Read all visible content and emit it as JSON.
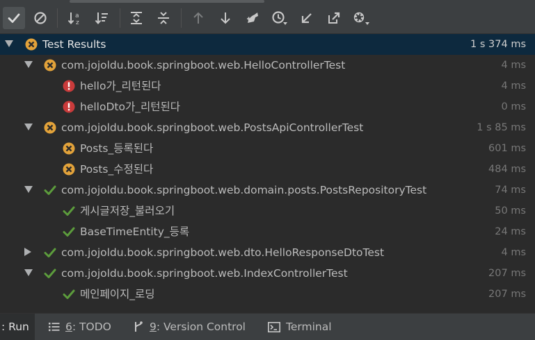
{
  "window_title": "Test Results",
  "tree": {
    "rows": [
      {
        "label": "Test Results",
        "time": "1 s 374 ms",
        "status": "ignored",
        "level": 0,
        "expand": "down",
        "selected": true
      },
      {
        "label": "com.jojoldu.book.springboot.web.HelloControllerTest",
        "time": "4 ms",
        "status": "ignored",
        "level": 1,
        "expand": "down"
      },
      {
        "label": "hello가_리턴된다",
        "time": "4 ms",
        "status": "error",
        "level": 2,
        "expand": "none"
      },
      {
        "label": "helloDto가_리턴된다",
        "time": "0 ms",
        "status": "error",
        "level": 2,
        "expand": "none"
      },
      {
        "label": "com.jojoldu.book.springboot.web.PostsApiControllerTest",
        "time": "1 s 85 ms",
        "status": "ignored",
        "level": 1,
        "expand": "down"
      },
      {
        "label": "Posts_등록된다",
        "time": "601 ms",
        "status": "ignored",
        "level": 2,
        "expand": "none"
      },
      {
        "label": "Posts_수정된다",
        "time": "484 ms",
        "status": "ignored",
        "level": 2,
        "expand": "none"
      },
      {
        "label": "com.jojoldu.book.springboot.web.domain.posts.PostsRepositoryTest",
        "time": "74 ms",
        "status": "passed",
        "level": 1,
        "expand": "down"
      },
      {
        "label": "게시글저장_불러오기",
        "time": "50 ms",
        "status": "passed",
        "level": 2,
        "expand": "none"
      },
      {
        "label": "BaseTimeEntity_등록",
        "time": "24 ms",
        "status": "passed",
        "level": 2,
        "expand": "none"
      },
      {
        "label": "com.jojoldu.book.springboot.web.dto.HelloResponseDtoTest",
        "time": "4 ms",
        "status": "passed",
        "level": 1,
        "expand": "right"
      },
      {
        "label": "com.jojoldu.book.springboot.web.IndexControllerTest",
        "time": "207 ms",
        "status": "passed",
        "level": 1,
        "expand": "down"
      },
      {
        "label": "메인페이지_로딩",
        "time": "207 ms",
        "status": "passed",
        "level": 2,
        "expand": "none"
      }
    ]
  },
  "bottom_tabs": {
    "run": {
      "prefix": "",
      "label": ": Run"
    },
    "todo": {
      "key": "6",
      "label": ": TODO"
    },
    "vcs": {
      "key": "9",
      "label": ": Version Control"
    },
    "terminal": {
      "label": "Terminal"
    }
  },
  "colors": {
    "ignored": "#e2a23a",
    "error": "#c93b3b",
    "passed": "#5c9c3c",
    "selected_row": "#0d293e",
    "tree_bg": "#2b2b2b"
  },
  "toolbar_icons": [
    "show-passed-icon",
    "show-ignored-icon",
    "sort-alphabetically-icon",
    "sort-by-duration-icon",
    "expand-all-icon",
    "collapse-all-icon",
    "previous-failed-icon",
    "next-failed-icon",
    "import-tests-icon",
    "test-history-icon",
    "export-test-results-icon",
    "open-external-icon",
    "settings-icon"
  ]
}
